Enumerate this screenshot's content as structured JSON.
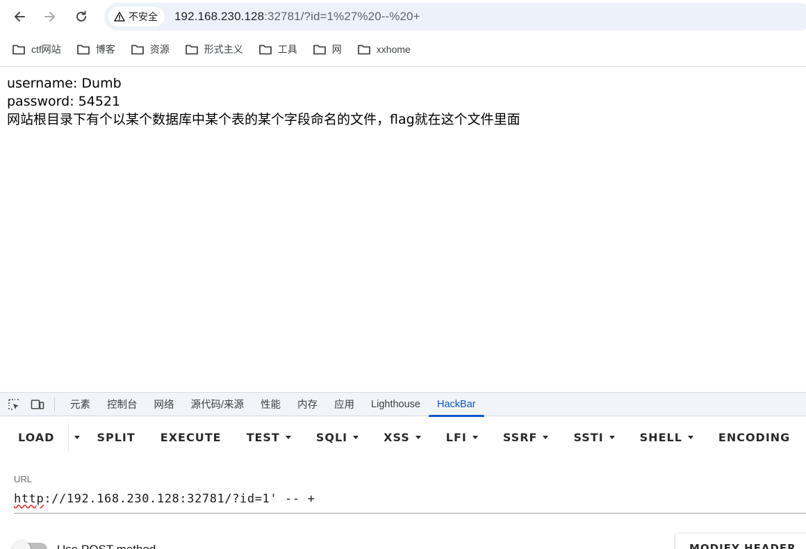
{
  "browser": {
    "security_label": "不安全",
    "url_host": "192.168.230.128",
    "url_rest": ":32781/?id=1%27%20--%20+"
  },
  "bookmarks": [
    {
      "label": "ctf网站"
    },
    {
      "label": "博客"
    },
    {
      "label": "资源"
    },
    {
      "label": "形式主义"
    },
    {
      "label": "工具"
    },
    {
      "label": "网"
    },
    {
      "label": "xxhome"
    }
  ],
  "page": {
    "username_line": "username: Dumb",
    "password_line": "password: 54521",
    "hint_line": "网站根目录下有个以某个数据库中某个表的某个字段命名的文件，flag就在这个文件里面"
  },
  "devtools": {
    "tabs": [
      "元素",
      "控制台",
      "网络",
      "源代码/来源",
      "性能",
      "内存",
      "应用",
      "Lighthouse",
      "HackBar"
    ],
    "active_tab": "HackBar"
  },
  "hackbar": {
    "load_label": "LOAD",
    "split_label": "SPLIT",
    "execute_label": "EXECUTE",
    "test_label": "TEST",
    "sqli_label": "SQLI",
    "xss_label": "XSS",
    "lfi_label": "LFI",
    "ssrf_label": "SSRF",
    "ssti_label": "SSTI",
    "shell_label": "SHELL",
    "encoding_label": "ENCODING",
    "url_label": "URL",
    "url_scheme": "http",
    "url_value_rest": "://192.168.230.128:32781/?id=1' -- +",
    "post_label": "Use POST method",
    "post_enabled": false,
    "modify_header_label": "MODIFY HEADER"
  },
  "colors": {
    "accent": "#0b57d0",
    "omnibox_bg": "#edf2fa",
    "devtools_bar_bg": "#f1f4f9"
  }
}
